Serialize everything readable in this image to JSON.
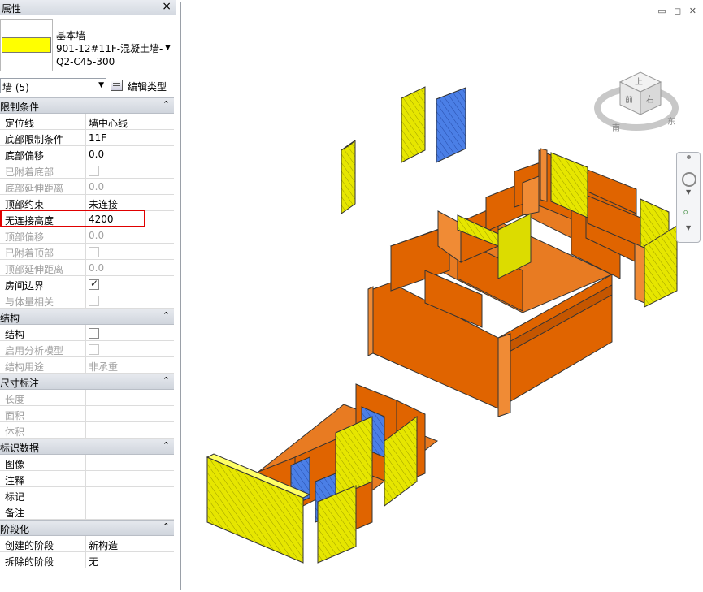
{
  "panel": {
    "title": "属性",
    "close_glyph": "×"
  },
  "type_selector": {
    "family": "基本墙",
    "type_line1": "901-12#11F-混凝土墙-",
    "type_line2": "Q2-C45-300",
    "swatch_color": "#ffff00"
  },
  "instance_selector": {
    "value": "墙 (5)",
    "edit_type_label": "编辑类型"
  },
  "groups": {
    "constraints": {
      "title": "限制条件",
      "rows": [
        {
          "name": "定位线",
          "value": "墙中心线"
        },
        {
          "name": "底部限制条件",
          "value": "11F"
        },
        {
          "name": "底部偏移",
          "value": "0.0"
        },
        {
          "name": "已附着底部",
          "value": ""
        },
        {
          "name": "底部延伸距离",
          "value": "0.0"
        },
        {
          "name": "顶部约束",
          "value": "未连接"
        },
        {
          "name": "无连接高度",
          "value": "4200"
        },
        {
          "name": "顶部偏移",
          "value": "0.0"
        },
        {
          "name": "已附着顶部",
          "value": ""
        },
        {
          "name": "顶部延伸距离",
          "value": "0.0"
        },
        {
          "name": "房间边界",
          "value": ""
        },
        {
          "name": "与体量相关",
          "value": ""
        }
      ]
    },
    "structure": {
      "title": "结构",
      "rows": [
        {
          "name": "结构",
          "value": ""
        },
        {
          "name": "启用分析模型",
          "value": ""
        },
        {
          "name": "结构用途",
          "value": "非承重"
        }
      ]
    },
    "dimensions": {
      "title": "尺寸标注",
      "rows": [
        {
          "name": "长度",
          "value": ""
        },
        {
          "name": "面积",
          "value": ""
        },
        {
          "name": "体积",
          "value": ""
        }
      ]
    },
    "identity": {
      "title": "标识数据",
      "rows": [
        {
          "name": "图像",
          "value": ""
        },
        {
          "name": "注释",
          "value": ""
        },
        {
          "name": "标记",
          "value": ""
        },
        {
          "name": "备注",
          "value": ""
        }
      ]
    },
    "phasing": {
      "title": "阶段化",
      "rows": [
        {
          "name": "创建的阶段",
          "value": "新构造"
        },
        {
          "name": "拆除的阶段",
          "value": "无"
        }
      ]
    },
    "toggle_glyph": "⌃"
  },
  "viewcube": {
    "top": "上",
    "front": "前",
    "right": "右",
    "compass_south": "南",
    "compass_east": "东"
  },
  "window_controls": "▭ ◻ ✕",
  "colors": {
    "wall_selected_top": "#eaea00",
    "wall_orange": "#e26a00",
    "wall_blue": "#4a7fe0",
    "highlight_box": "#e00000"
  }
}
